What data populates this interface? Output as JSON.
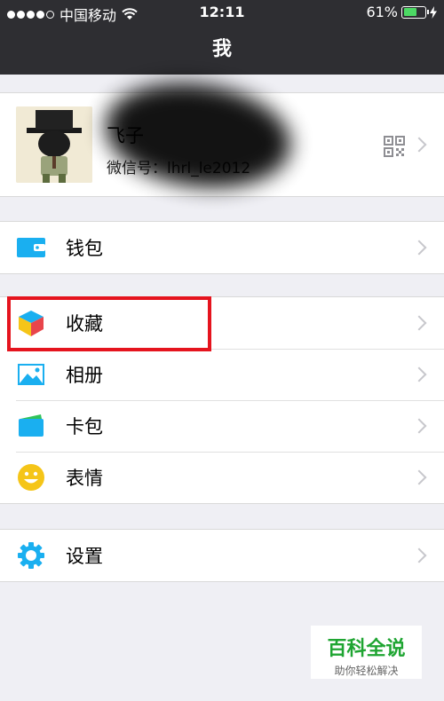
{
  "status_bar": {
    "carrier": "中国移动",
    "time": "12:11",
    "battery": "61%",
    "battery_level": 0.61,
    "icons": [
      "signal-icon",
      "wifi-icon",
      "battery-icon",
      "charging-icon"
    ]
  },
  "nav": {
    "title": "我"
  },
  "profile": {
    "name": "飞子",
    "wechat_id": "微信号：lhrl_le2012",
    "icons": [
      "avatar",
      "qr-code-icon",
      "chevron-right-icon"
    ]
  },
  "menu": {
    "wallet": {
      "label": "钱包",
      "icon": "wallet-icon"
    },
    "favorites": {
      "label": "收藏",
      "icon": "cube-icon"
    },
    "album": {
      "label": "相册",
      "icon": "image-icon"
    },
    "cards": {
      "label": "卡包",
      "icon": "card-icon"
    },
    "stickers": {
      "label": "表情",
      "icon": "smiley-icon"
    },
    "settings": {
      "label": "设置",
      "icon": "gear-icon"
    }
  },
  "colors": {
    "nav_bg": "#2e2e32",
    "highlight": "#e5141e",
    "accent_blue": "#1aaff0",
    "watermark_green": "#1fa532"
  },
  "watermark": {
    "title": "百科全说",
    "subtitle": "助你轻松解决"
  }
}
